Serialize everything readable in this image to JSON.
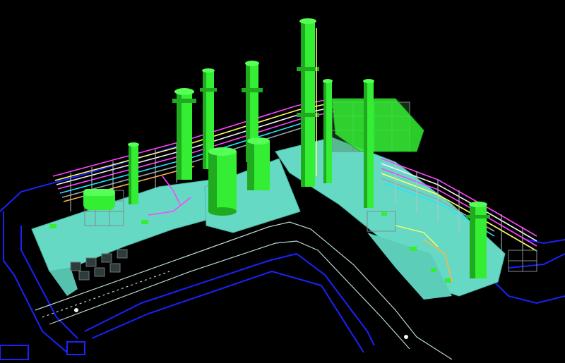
{
  "scene": {
    "name": "3d-plant-model-render",
    "background": "#000000",
    "colors": {
      "equipment": "#33ee33",
      "equipment_shade": "#1faa1f",
      "slab": "#66d9c4",
      "slab_edge": "#4bb8a5",
      "boundary": "#1a22ff",
      "road": "#b8d8d0",
      "pipe_magenta": "#ff44ff",
      "pipe_yellow": "#ffff66",
      "pipe_white": "#f2f2f2",
      "pipe_orange": "#ffb347",
      "pipe_cyan": "#22e5ff",
      "pipe_gray": "#9aa6a8",
      "grating": "#7f8a8c"
    },
    "icons": [
      "column-tower",
      "stack",
      "vessel",
      "pipe-rack",
      "pump",
      "structural-frame"
    ]
  }
}
